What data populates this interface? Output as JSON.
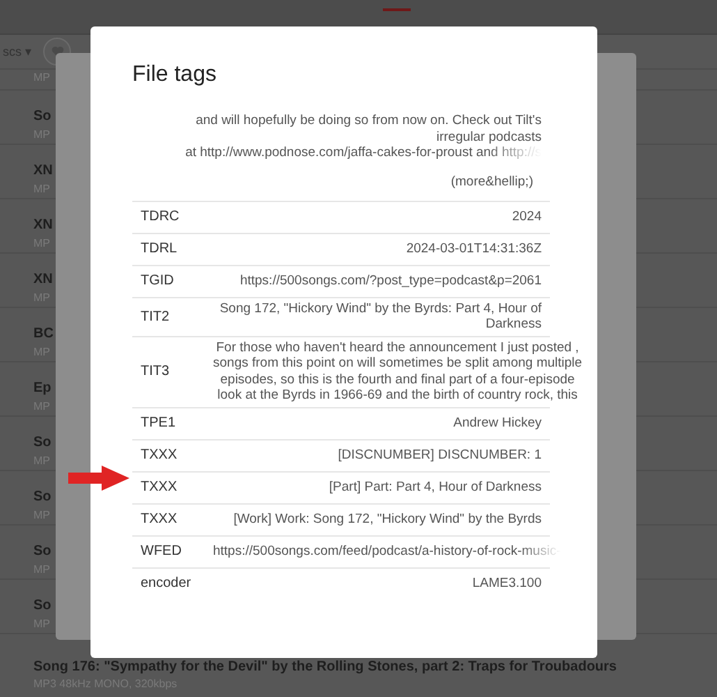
{
  "toolbar": {
    "dropdown": "scs ▾"
  },
  "list": {
    "rows": [
      {
        "subtitle": "MP"
      },
      {
        "title": "So",
        "subtitle": "MP"
      },
      {
        "title": "XN",
        "subtitle": "MP"
      },
      {
        "title": "XN",
        "subtitle": "MP"
      },
      {
        "title": "XN",
        "subtitle": "MP"
      },
      {
        "title": "BC",
        "subtitle": "MP"
      },
      {
        "title": "Ep",
        "subtitle": "MP"
      },
      {
        "title": "So",
        "subtitle": "MP"
      },
      {
        "title": "So",
        "subtitle": "MP"
      },
      {
        "title": "So",
        "subtitle": "MP"
      },
      {
        "title": "So",
        "subtitle": "MP"
      },
      {
        "title": "Song 176: \"Sympathy for the Devil\" by the Rolling Stones, part 2: Traps for Troubadours",
        "subtitle": "MP3 48kHz MONO, 320kbps"
      }
    ]
  },
  "dialog": {
    "title": "File tags",
    "description": [
      {
        "text": "and will hopefully be doing so from now on. Check out Tilt's",
        "faded": false
      },
      {
        "text": "irregular podcasts",
        "faded": false
      },
      {
        "text": "at http://www.podnose.com/jaffa-cakes-for-proust and http://s",
        "faded": true
      }
    ],
    "more": "(more&hellip;)",
    "tags": [
      {
        "key": "TDRC",
        "lines": [
          "2024"
        ],
        "kind": "text",
        "faded": false
      },
      {
        "key": "TDRL",
        "lines": [
          "2024-03-01T14:31:36Z"
        ],
        "kind": "text",
        "faded": false
      },
      {
        "key": "TGID",
        "lines": [
          "https://500songs.com/?post_type=podcast&p=2061"
        ],
        "kind": "text",
        "faded": false
      },
      {
        "key": "TIT2",
        "lines": [
          "Song 172, \"Hickory Wind\" by the Byrds: Part 4, Hour of",
          "Darkness"
        ],
        "kind": "text",
        "faded": false
      },
      {
        "key": "TIT3",
        "lines": [
          "For those who haven't heard the announcement I just posted ,",
          "songs from this point on will sometimes be split among multiple",
          "episodes, so this is the fourth and final part of a four-episode",
          "look at the Byrds in 1966-69 and the birth of country rock, this"
        ],
        "kind": "paragraph",
        "faded": false
      },
      {
        "key": "TPE1",
        "lines": [
          "Andrew Hickey"
        ],
        "kind": "text",
        "faded": false
      },
      {
        "key": "TXXX",
        "lines": [
          "[DISCNUMBER] DISCNUMBER: 1"
        ],
        "kind": "text",
        "faded": false
      },
      {
        "key": "TXXX",
        "lines": [
          "[Part] Part: Part 4, Hour of Darkness"
        ],
        "kind": "text",
        "faded": false
      },
      {
        "key": "TXXX",
        "lines": [
          "[Work] Work: Song 172, \"Hickory Wind\" by the Byrds"
        ],
        "kind": "text",
        "faded": false
      },
      {
        "key": "WFED",
        "lines": [
          "https://500songs.com/feed/podcast/a-history-of-rock-music-"
        ],
        "kind": "text",
        "faded": true
      },
      {
        "key": "encoder",
        "lines": [
          "LAME3.100"
        ],
        "kind": "text",
        "faded": false
      }
    ]
  }
}
